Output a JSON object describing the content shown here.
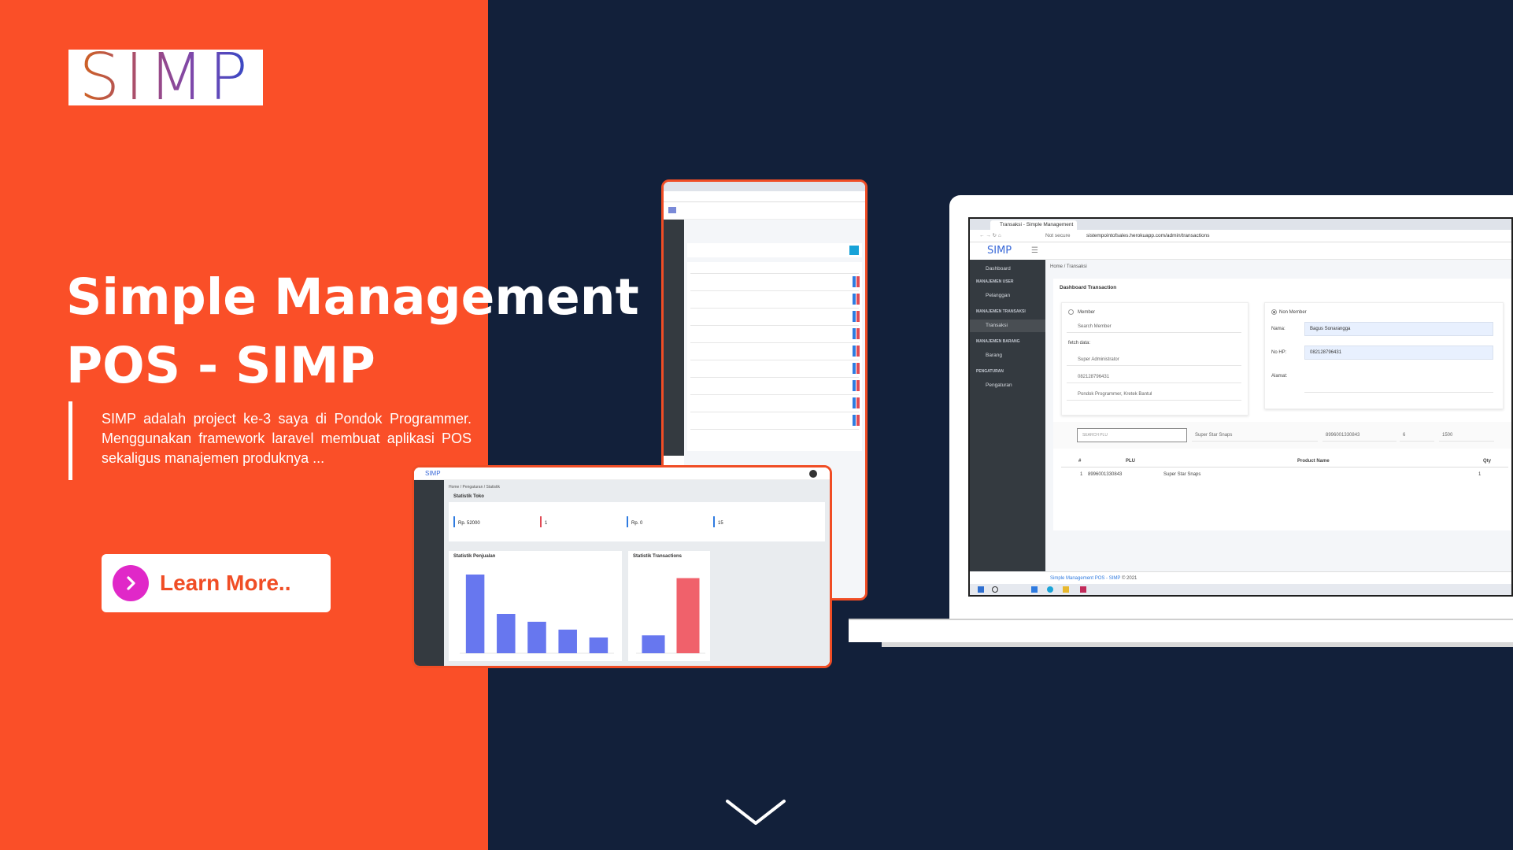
{
  "logo": {
    "text": "SIMP"
  },
  "hero": {
    "title_line1": "Simple Management",
    "title_line2": "POS - SIMP",
    "description": "SIMP adalah project ke-3 saya di Pondok Programmer. Menggunakan framework laravel membuat aplikasi POS sekaligus manajemen produknya ..."
  },
  "cta": {
    "label": "Learn More..",
    "icon": "chevron-right-icon"
  },
  "scroll": {
    "icon": "chevron-down-icon"
  },
  "colors": {
    "left_bg": "#fa4f28",
    "right_bg": "#12203a",
    "cta_circle": "#e028c8",
    "cta_text": "#f04d25",
    "sidebar": "#343a40",
    "brand_blue": "#3868d8"
  },
  "transaction_app": {
    "tab_title": "Transaksi - Simple Management",
    "not_secure": "Not secure",
    "url": "sistempointofsales.herokuapp.com/admin/transactions",
    "brand": "SIMP",
    "sidebar": {
      "dashboard": "Dashboard",
      "section_user": "MANAJEMEN USER",
      "pelanggan": "Pelanggan",
      "section_transaksi": "MANAJEMEN TRANSAKSI",
      "transaksi": "Transaksi",
      "section_barang": "MANAJEMEN BARANG",
      "barang": "Barang",
      "section_pengaturan": "PENGATURAN",
      "pengaturan": "Pengaturan"
    },
    "breadcrumb": "Home / Transaksi",
    "card_title": "Dashboard Transaction",
    "member": {
      "label": "Member",
      "search_placeholder": "Search Member",
      "fetch_label": "fetch data:",
      "fetched": [
        "Super Administrator",
        "082128796431",
        "Pondok Programmer, Kretek Bantul"
      ]
    },
    "non_member": {
      "label": "Non Member",
      "name_label": "Nama:",
      "name_value": "Bagus Sonarangga",
      "phone_label": "No HP:",
      "phone_value": "082128796431",
      "address_label": "Alamat:"
    },
    "search_plu": {
      "placeholder": "SEARCH PLU",
      "product": "Super Star Snaps",
      "plu": "8996001330843",
      "qty": "6",
      "price": "1500"
    },
    "table": {
      "headers": [
        "#",
        "PLU",
        "Product Name",
        "Qty"
      ],
      "rows": [
        [
          "1",
          "8996001330843",
          "Super Star Snaps",
          "1"
        ]
      ]
    },
    "footer": {
      "link": "Simple Management POS - SIMP",
      "suffix": "© 2021"
    }
  },
  "dashboard_app": {
    "breadcrumb": "Home / Pengaturan / Statistik",
    "stat_title": "Statistik Toko",
    "stats": [
      {
        "value": "Rp. 52000",
        "color": "#2f7be0"
      },
      {
        "value": "1",
        "color": "#e04a55"
      },
      {
        "value": "Rp. 0",
        "color": "#2f7be0"
      },
      {
        "value": "15",
        "color": "#2f7be0"
      }
    ],
    "chart1_title": "Statistik Penjualan",
    "chart2_title": "Statistik Transactions"
  },
  "chart_data": [
    {
      "type": "bar",
      "title": "Statistik Penjualan",
      "values": [
        10,
        5,
        4,
        3,
        2
      ],
      "ylim": [
        0,
        10
      ],
      "color": "#6777ef"
    },
    {
      "type": "bar",
      "title": "Statistik Transactions",
      "values": [
        0.5,
        2.1
      ],
      "ylim": [
        0,
        2.2
      ],
      "colors": [
        "#6777ef",
        "#f0616b"
      ]
    }
  ]
}
